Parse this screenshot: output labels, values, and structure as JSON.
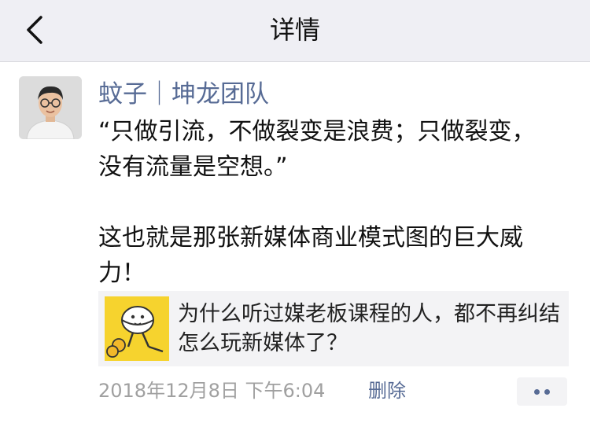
{
  "navbar": {
    "title": "详情",
    "back_icon": "chevron-left-icon"
  },
  "post": {
    "author": "蚊子｜坤龙团队",
    "content": "“只做引流，不做裂变是浪费；只做裂变，没有流量是空想。”\n\n这也就是那张新媒体商业模式图的巨大威力！",
    "link": {
      "thumbnail_icon": "cartoon-egg-thumbnail",
      "title": "为什么听过媒老板课程的人，都不再纠结怎么玩新媒体了？"
    },
    "time": "2018年12月8日 下午6:04",
    "delete_label": "删除",
    "more_icon": "more-dots-icon"
  },
  "colors": {
    "nav_background": "#efeff4",
    "author_link": "#576b95",
    "thumbnail_yellow": "#f6d32e"
  }
}
